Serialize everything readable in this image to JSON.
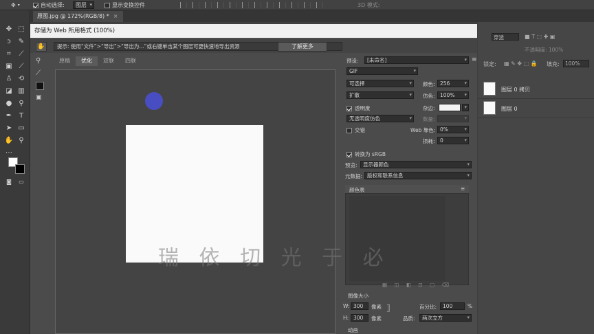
{
  "optionbar": {
    "auto_select_label": "自动选择:",
    "auto_select_value": "图层",
    "show_transform_label": "显示变换控件",
    "mode_label": "3D 模式:"
  },
  "document_tab": {
    "title": "原图.jpg @ 172%(RGB/8) *"
  },
  "dialog": {
    "title": "存储为 Web 所用格式 (100%)",
    "tip": "提示: 使用“文件”>“导出”>“导出为...”或右键单击某个图层可更快速地导出资源",
    "learn_more": "了解更多",
    "view_tabs": [
      "原稿",
      "优化",
      "双联",
      "四联"
    ],
    "active_view_tab": "优化",
    "preset_label": "预设:",
    "preset_value": "[未命名]",
    "format": "GIF",
    "reduction": "可选择",
    "colors_label": "颜色:",
    "colors_value": "256",
    "dither_algo": "扩散",
    "dither_label": "仿色:",
    "dither_value": "100%",
    "transparency_label": "透明度",
    "matte_label": "杂边:",
    "no_transparency_dither": "无透明度仿色",
    "amount_label": "数量:",
    "interlaced_label": "交错",
    "web_snap_label": "Web 靠色:",
    "web_snap_value": "0%",
    "lossy_label": "损耗:",
    "lossy_value": "0",
    "convert_srgb_label": "转换为 sRGB",
    "preview_label": "预览:",
    "preview_value": "显示器颜色",
    "metadata_label": "元数据:",
    "metadata_value": "版权和联系信息",
    "color_table_label": "颜色表",
    "image_size_label": "图像大小",
    "width_label": "W:",
    "width_value": "300",
    "height_label": "H:",
    "height_value": "300",
    "pixel_unit": "像素",
    "percent_label": "百分比:",
    "percent_value": "100",
    "percent_unit": "%",
    "quality_label": "品质:",
    "quality_value": "两次立方",
    "animation_label": "动画",
    "watermark_text": "瑞 依 切 光 于 必"
  },
  "rightpanel": {
    "lock_label": "锁定:",
    "fill_label": "填充:",
    "fill_value": "100%",
    "opacity_value": "不透明度: 100%",
    "blend_mode": "穿透",
    "layers": [
      {
        "name": "图层 0 拷贝"
      },
      {
        "name": "图层 0"
      }
    ]
  }
}
